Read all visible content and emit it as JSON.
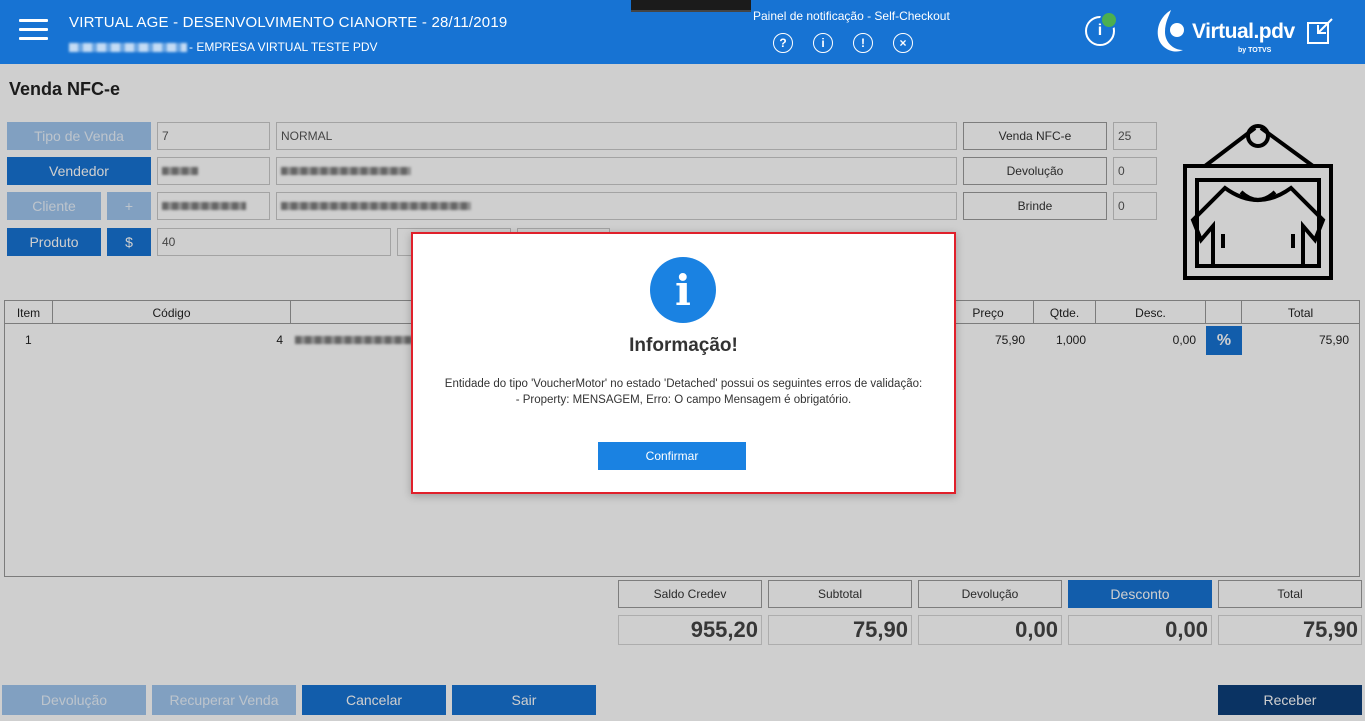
{
  "header": {
    "title": "VIRTUAL AGE - DESENVOLVIMENTO CIANORTE - 28/11/2019",
    "subtitle": "- EMPRESA VIRTUAL TESTE PDV",
    "notification_panel": "Painel de notificação - Self-Checkout",
    "logo_text": "Virtual.pdv",
    "logo_by": "by TOTVS"
  },
  "page_title": "Venda NFC-e",
  "form": {
    "tipo_venda_label": "Tipo de Venda",
    "tipo_venda_code": "7",
    "tipo_venda_desc": "NORMAL",
    "vendedor_label": "Vendedor",
    "cliente_label": "Cliente",
    "cliente_add": "+",
    "produto_label": "Produto",
    "produto_price_btn": "$",
    "produto_value": "40",
    "venda_nfce_label": "Venda NFC-e",
    "venda_nfce_value": "25",
    "devolucao_label": "Devolução",
    "devolucao_value": "0",
    "brinde_label": "Brinde",
    "brinde_value": "0"
  },
  "table": {
    "headers": [
      "Item",
      "Código",
      "Preço",
      "Qtde.",
      "Desc.",
      "Total"
    ],
    "rows": [
      {
        "item": "1",
        "codigo": "4",
        "preco": "75,90",
        "qtde": "1,000",
        "desc": "0,00",
        "total": "75,90"
      }
    ]
  },
  "totals": {
    "saldo_credev_label": "Saldo Credev",
    "saldo_credev_value": "955,20",
    "subtotal_label": "Subtotal",
    "subtotal_value": "75,90",
    "devolucao_label": "Devolução",
    "devolucao_value": "0,00",
    "desconto_label": "Desconto",
    "desconto_value": "0,00",
    "total_label": "Total",
    "total_value": "75,90"
  },
  "bottom_buttons": {
    "devolucao": "Devolução",
    "recuperar": "Recuperar Venda",
    "cancelar": "Cancelar",
    "sair": "Sair",
    "receber": "Receber"
  },
  "dialog": {
    "title": "Informação!",
    "message_line1": "Entidade do tipo 'VoucherMotor' no estado 'Detached' possui os seguintes erros de validação:",
    "message_line2": "- Property: MENSAGEM, Erro: O campo Mensagem é obrigatório.",
    "confirm": "Confirmar"
  },
  "colors": {
    "primary": "#1773d3",
    "primary_dark": "#0d3f7a",
    "dialog_border": "#e0202b",
    "status_green": "#4caf50"
  }
}
